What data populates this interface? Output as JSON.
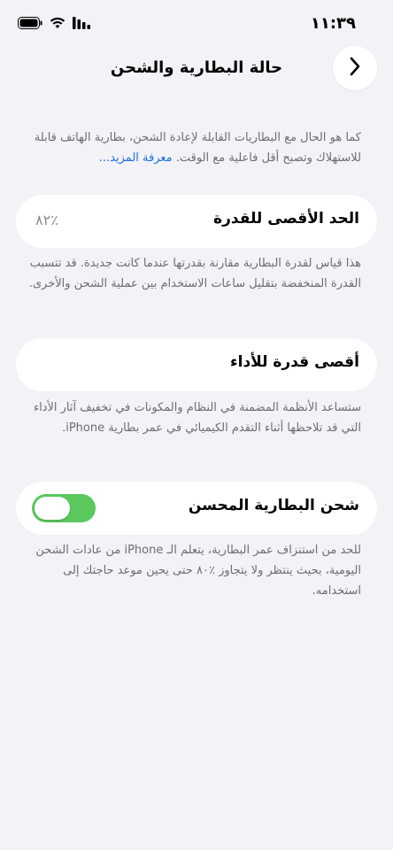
{
  "status_bar": {
    "time": "١١:٣٩",
    "icons": [
      "signal-icon",
      "wifi-icon",
      "battery-icon"
    ]
  },
  "nav": {
    "title": "حالة البطارية والشحن",
    "back_icon": "chevron-right-icon"
  },
  "intro": {
    "text": "كما هو الحال مع البطاريات القابلة لإعادة الشحن، بطارية الهاتف قابلة للاستهلاك وتصبح أقل فاعلية مع الوقت.",
    "link": "معرفة المزيد..."
  },
  "max_capacity": {
    "label": "الحد الأقصى للقدرة",
    "value": "٪٨٢",
    "footnote": "هذا قياس لقدرة البطارية مقارنة بقدرتها عندما كانت جديدة. قد تتسبب القدرة المنخفضة بتقليل ساعات الاستخدام بين عملية الشحن والأخرى."
  },
  "peak_performance": {
    "label": "أقصى قدرة للأداء",
    "footnote": "ستساعد الأنظمة المضمنة في النظام والمكونات في تخفيف آثار الأداء التي قد تلاحظها أثناء التقدم الكيميائي في عمر بطارية iPhone."
  },
  "optimized_charging": {
    "label": "شحن البطارية المحسن",
    "enabled": true,
    "footnote": "للحد من استنزاف عمر البطارية، يتعلم الـ iPhone من عادات الشحن اليومية، بحيث ينتظر ولا يتجاوز ٪٨٠ حتى يحين موعد حاجتك إلى استخدامه."
  },
  "colors": {
    "background": "#f2f2f7",
    "card": "#ffffff",
    "toggle_on": "#5ac85d",
    "link": "#1f6fe0",
    "secondary_text": "#6d6d72"
  }
}
